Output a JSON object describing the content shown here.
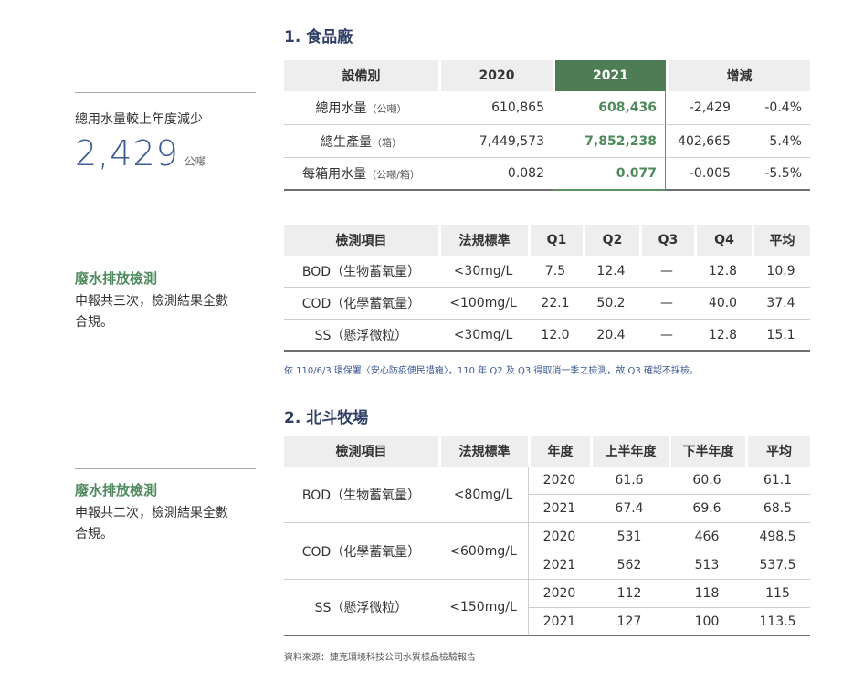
{
  "section1": {
    "title": "1.  食品廠",
    "summary": {
      "label": "總用水量較上年度減少",
      "value": "2,429",
      "unit": "公噸"
    },
    "table1": {
      "headers": [
        "設備別",
        "2020",
        "2021",
        "增減"
      ],
      "rows": [
        {
          "name": "總用水量",
          "unit": "（公噸）",
          "v2020": "610,865",
          "v2021": "608,436",
          "diff": "-2,429",
          "pct": "-0.4%"
        },
        {
          "name": "總生產量",
          "unit": "（箱）",
          "v2020": "7,449,573",
          "v2021": "7,852,238",
          "diff": "402,665",
          "pct": "5.4%"
        },
        {
          "name": "每箱用水量",
          "unit": "（公噸/箱）",
          "v2020": "0.082",
          "v2021": "0.077",
          "diff": "-0.005",
          "pct": "-5.5%"
        }
      ]
    },
    "wastewater": {
      "title": "廢水排放檢測",
      "desc": "申報共三次，檢測結果全數合規。"
    },
    "table2": {
      "headers": [
        "檢測項目",
        "法規標準",
        "Q1",
        "Q2",
        "Q3",
        "Q4",
        "平均"
      ],
      "rows": [
        [
          "BOD（生物蓄氧量）",
          "<30mg/L",
          "7.5",
          "12.4",
          "—",
          "12.8",
          "10.9"
        ],
        [
          "COD（化學蓄氧量）",
          "<100mg/L",
          "22.1",
          "50.2",
          "—",
          "40.0",
          "37.4"
        ],
        [
          "SS（懸浮微粒）",
          "<30mg/L",
          "12.0",
          "20.4",
          "—",
          "12.8",
          "15.1"
        ]
      ]
    },
    "note": "依 110/6/3 環保署〈安心防疫便民措施〉，110 年 Q2 及 Q3 得取消一季之檢測，故 Q3 確認不採檢。"
  },
  "section2": {
    "title": "2.  北斗牧場",
    "wastewater": {
      "title": "廢水排放檢測",
      "desc": "申報共二次，檢測結果全數合規。"
    },
    "table": {
      "headers": [
        "檢測項目",
        "法規標準",
        "年度",
        "上半年度",
        "下半年度",
        "平均"
      ],
      "groups": [
        {
          "item": "BOD（生物蓄氧量）",
          "std": "<80mg/L",
          "rows": [
            [
              "2020",
              "61.6",
              "60.6",
              "61.1"
            ],
            [
              "2021",
              "67.4",
              "69.6",
              "68.5"
            ]
          ]
        },
        {
          "item": "COD（化學蓄氧量）",
          "std": "<600mg/L",
          "rows": [
            [
              "2020",
              "531",
              "466",
              "498.5"
            ],
            [
              "2021",
              "562",
              "513",
              "537.5"
            ]
          ]
        },
        {
          "item": "SS（懸浮微粒）",
          "std": "<150mg/L",
          "rows": [
            [
              "2020",
              "112",
              "118",
              "115"
            ],
            [
              "2021",
              "127",
              "100",
              "113.5"
            ]
          ]
        }
      ]
    },
    "source": "資料來源：婕克環境科技公司水質樣品檢驗報告"
  }
}
